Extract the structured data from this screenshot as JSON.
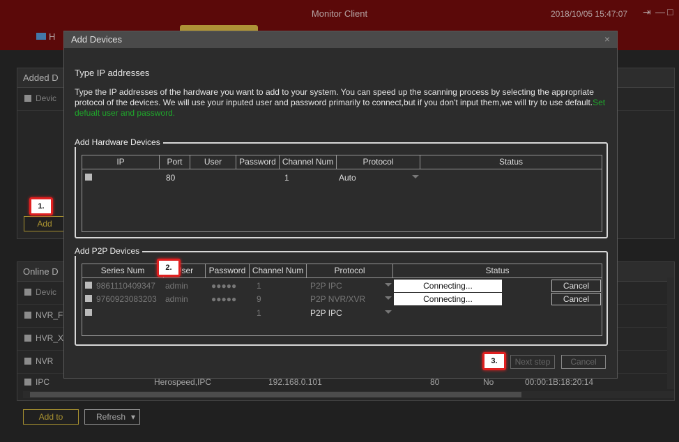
{
  "window": {
    "title": "Monitor Client",
    "datetime": "2018/10/05 15:47:07",
    "home_tab": "H"
  },
  "added_panel": {
    "title": "Added D",
    "header_col": "Devic",
    "add_button": "Add"
  },
  "online_panel": {
    "title": "Online D",
    "header_col": "Devic",
    "rows": [
      {
        "name": "NVR_F"
      },
      {
        "name": "HVR_X"
      },
      {
        "name": "NVR"
      },
      {
        "name": "IPC",
        "vendor": "Herospeed,IPC",
        "ip": "192.168.0.101",
        "port": "80",
        "added": "No",
        "mac": "00:00:1B:18:20:14"
      }
    ],
    "add_to_button": "Add to",
    "refresh_button": "Refresh"
  },
  "dialog": {
    "title": "Add Devices",
    "close": "×",
    "heading": "Type IP addresses",
    "description": "Type the IP addresses of the hardware you want to add to your system. You can speed up the scanning process by selecting the appropriate protocol of the devices. We will use your inputed user and password primarily to connect,but if you don't input them,we will try to use default.",
    "default_link": "Set defualt user and password.",
    "hardware": {
      "legend": "Add Hardware Devices",
      "columns": [
        "IP",
        "Port",
        "User",
        "Password",
        "Channel Num",
        "Protocol",
        "Status"
      ],
      "rows": [
        {
          "ip": "",
          "port": "80",
          "user": "",
          "password": "",
          "channel": "1",
          "protocol": "Auto",
          "status": ""
        }
      ]
    },
    "p2p": {
      "legend": "Add P2P Devices",
      "columns": [
        "Series Num",
        "User",
        "Password",
        "Channel Num",
        "Protocol",
        "Status"
      ],
      "rows": [
        {
          "series": "9861110409347",
          "user": "admin",
          "password": "●●●●●",
          "channel": "1",
          "protocol": "P2P IPC",
          "status": "Connecting...",
          "action": "Cancel"
        },
        {
          "series": "9760923083203",
          "user": "admin",
          "password": "●●●●●",
          "channel": "9",
          "protocol": "P2P NVR/XVR",
          "status": "Connecting...",
          "action": "Cancel"
        },
        {
          "series": "",
          "user": "",
          "password": "",
          "channel": "1",
          "protocol": "P2P IPC",
          "status": "",
          "action": ""
        }
      ]
    },
    "next_button": "Next step",
    "cancel_button": "Cancel"
  },
  "annotations": [
    "1.",
    "2.",
    "3."
  ]
}
